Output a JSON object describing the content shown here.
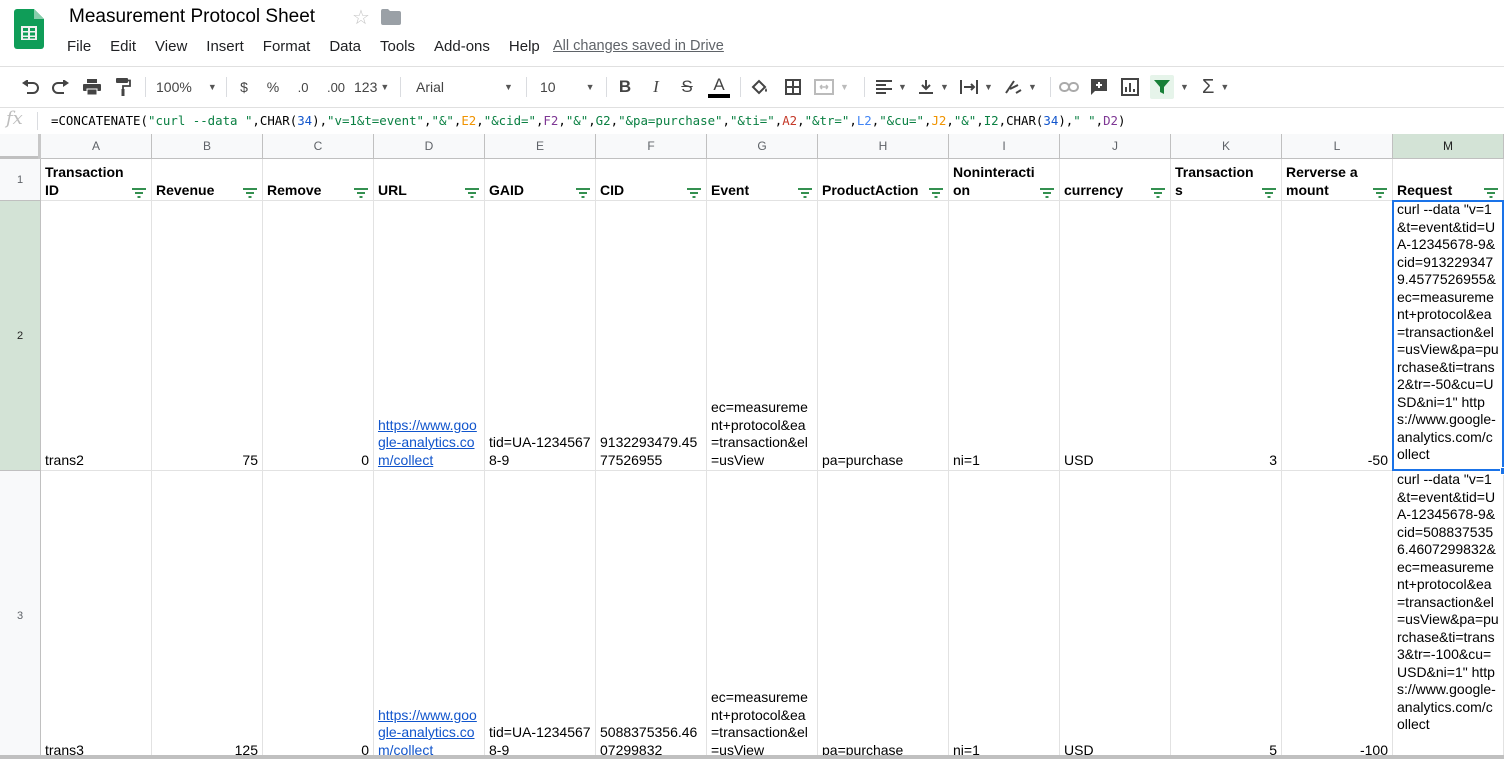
{
  "app": {
    "doc_title": "Measurement Protocol Sheet",
    "menu": [
      "File",
      "Edit",
      "View",
      "Insert",
      "Format",
      "Data",
      "Tools",
      "Add-ons",
      "Help"
    ],
    "save_status": "All changes saved in Drive"
  },
  "toolbar": {
    "zoom": "100%",
    "currency": "$",
    "percent": "%",
    "decrease_decimal": ".0",
    "increase_decimal": ".00",
    "more_formats": "123",
    "font": "Arial",
    "font_size": "10",
    "bold": "B",
    "italic": "I",
    "strike": "S",
    "text_color": "A",
    "text_color_value": "#000000",
    "sum": "Σ",
    "accent": "#188038"
  },
  "formula_bar": {
    "fx_label": "fx",
    "tokens": [
      {
        "t": "=CONCATENATE(",
        "c": "plain"
      },
      {
        "t": "\"curl --data \"",
        "c": "str"
      },
      {
        "t": ",CHAR(",
        "c": "plain"
      },
      {
        "t": "34",
        "c": "num"
      },
      {
        "t": "),",
        "c": "plain"
      },
      {
        "t": "\"v=1&t=event\"",
        "c": "str"
      },
      {
        "t": ",",
        "c": "plain"
      },
      {
        "t": "\"&\"",
        "c": "str"
      },
      {
        "t": ",",
        "c": "plain"
      },
      {
        "t": "E2",
        "c": "refE"
      },
      {
        "t": ",",
        "c": "plain"
      },
      {
        "t": "\"&cid=\"",
        "c": "str"
      },
      {
        "t": ",",
        "c": "plain"
      },
      {
        "t": "F2",
        "c": "refF"
      },
      {
        "t": ",",
        "c": "plain"
      },
      {
        "t": "\"&\"",
        "c": "str"
      },
      {
        "t": ",",
        "c": "plain"
      },
      {
        "t": "G2",
        "c": "refG"
      },
      {
        "t": ",",
        "c": "plain"
      },
      {
        "t": "\"&pa=purchase\"",
        "c": "str"
      },
      {
        "t": ",",
        "c": "plain"
      },
      {
        "t": "\"&ti=\"",
        "c": "str"
      },
      {
        "t": ",",
        "c": "plain"
      },
      {
        "t": "A2",
        "c": "refA"
      },
      {
        "t": ",",
        "c": "plain"
      },
      {
        "t": "\"&tr=\"",
        "c": "str"
      },
      {
        "t": ",",
        "c": "plain"
      },
      {
        "t": "L2",
        "c": "refL"
      },
      {
        "t": ",",
        "c": "plain"
      },
      {
        "t": "\"&cu=\"",
        "c": "str"
      },
      {
        "t": ",",
        "c": "plain"
      },
      {
        "t": "J2",
        "c": "refJ"
      },
      {
        "t": ",",
        "c": "plain"
      },
      {
        "t": "\"&\"",
        "c": "str"
      },
      {
        "t": ",",
        "c": "plain"
      },
      {
        "t": "I2",
        "c": "refI"
      },
      {
        "t": ",CHAR(",
        "c": "plain"
      },
      {
        "t": "34",
        "c": "num"
      },
      {
        "t": "),",
        "c": "plain"
      },
      {
        "t": "\" \"",
        "c": "str"
      },
      {
        "t": ",",
        "c": "plain"
      },
      {
        "t": "D2",
        "c": "refD"
      },
      {
        "t": ")",
        "c": "plain"
      }
    ]
  },
  "sheet": {
    "columns": [
      "A",
      "B",
      "C",
      "D",
      "E",
      "F",
      "G",
      "H",
      "I",
      "J",
      "K",
      "L",
      "M"
    ],
    "selected_column": "M",
    "selected_row": "2",
    "header_row_label": "1",
    "headers": [
      "Transaction ID",
      "Revenue",
      "Remove",
      "URL",
      "GAID",
      "CID",
      "Event",
      "ProductAction",
      "Noninteraction",
      "currency",
      "Transactions",
      "Rerverse amount",
      "Request"
    ],
    "rows": [
      {
        "label": "2",
        "cells": [
          "trans2",
          "75",
          "0",
          "https://www.google-analytics.com/collect",
          "tid=UA-12345678-9",
          "9132293479.4577526955",
          "ec=measurement+protocol&ea=transaction&el=usView",
          "pa=purchase",
          "ni=1",
          "USD",
          "3",
          "-50",
          "curl --data \"v=1&t=event&tid=UA-12345678-9&cid=9132293479.4577526955&ec=measurement+protocol&ea=transaction&el=usView&pa=purchase&ti=trans2&tr=-50&cu=USD&ni=1\" https://www.google-analytics.com/collect"
        ]
      },
      {
        "label": "3",
        "cells": [
          "trans3",
          "125",
          "0",
          "https://www.google-analytics.com/collect",
          "tid=UA-12345678-9",
          "5088375356.4607299832",
          "ec=measurement+protocol&ea=transaction&el=usView",
          "pa=purchase",
          "ni=1",
          "USD",
          "5",
          "-100",
          "curl --data \"v=1&t=event&tid=UA-12345678-9&cid=5088375356.4607299832&ec=measurement+protocol&ea=transaction&el=usView&pa=purchase&ti=trans3&tr=-100&cu=USD&ni=1\" https://www.google-analytics.com/collect"
        ]
      }
    ]
  }
}
